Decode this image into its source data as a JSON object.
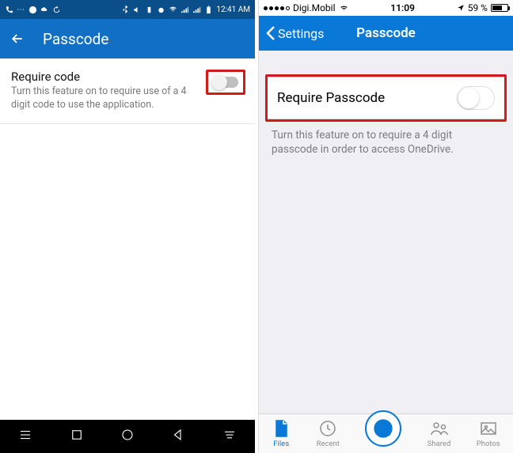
{
  "android": {
    "status_time": "12:41 AM",
    "header_title": "Passcode",
    "row": {
      "title": "Require code",
      "subtitle": "Turn this feature on to require use of a 4 digit code to use the application."
    }
  },
  "ios": {
    "status_carrier": "Digi.Mobil",
    "status_time": "11:09",
    "status_battery": "59 %",
    "header_back": "Settings",
    "header_title": "Passcode",
    "row_label": "Require Passcode",
    "row_desc": "Turn this feature on to require a 4 digit passcode in order to access OneDrive.",
    "tabs": {
      "files": "Files",
      "recent": "Recent",
      "shared": "Shared",
      "photos": "Photos"
    }
  }
}
